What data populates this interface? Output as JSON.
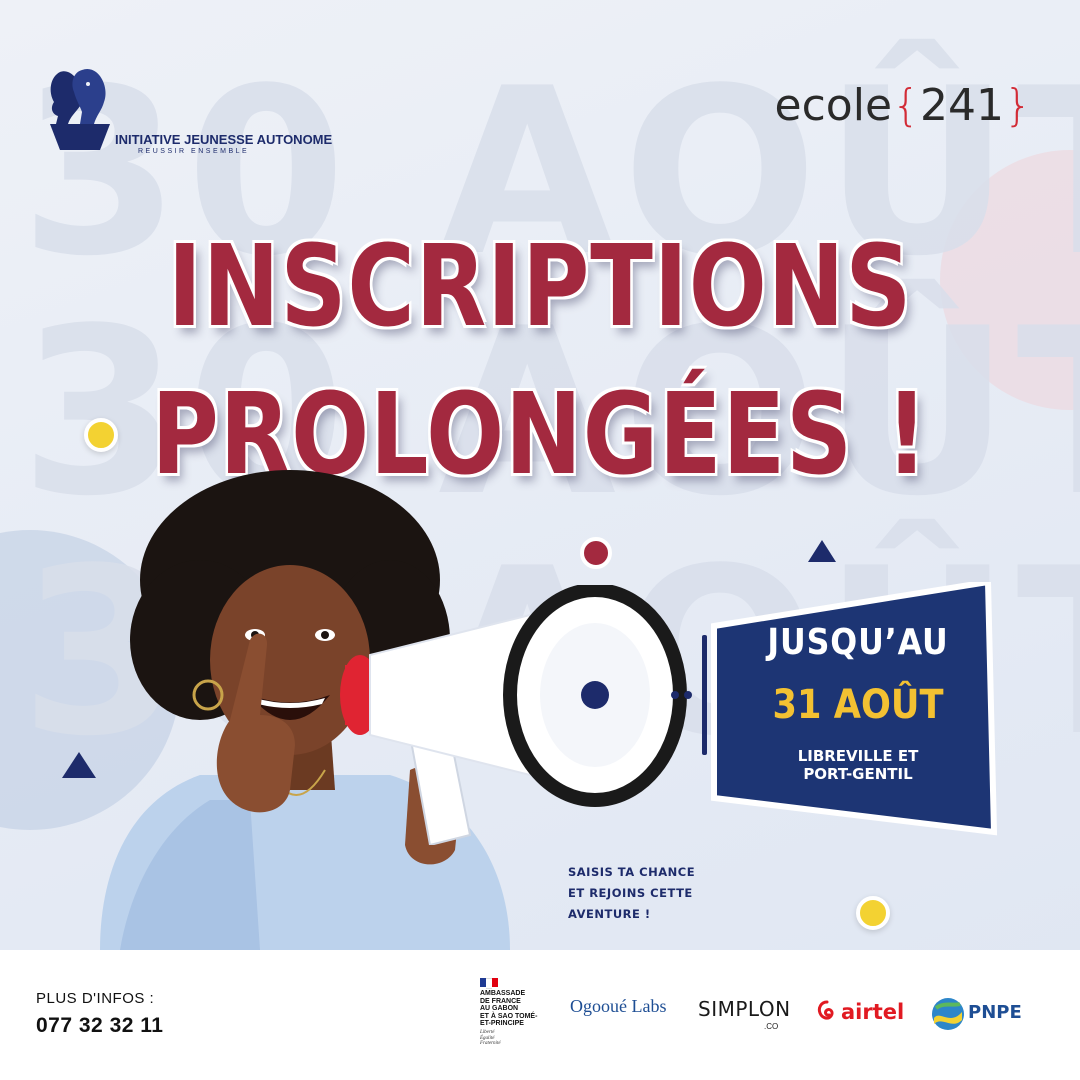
{
  "background_words": {
    "line1": "30 AOÛT",
    "line2": "30 AOÛT",
    "line3": "30 AOÛT"
  },
  "header": {
    "partner_logo": {
      "title": "INITIATIVE JEUNESSE AUTONOME",
      "subtitle": "REUSSIR ENSEMBLE"
    },
    "brand_logo": {
      "word": "ecole",
      "open_brace": "{",
      "number": "241",
      "close_brace": "}"
    }
  },
  "headline": {
    "line1": "INSCRIPTIONS",
    "line2": "PROLONGÉES !"
  },
  "date_box": {
    "line1": "JUSQU’AU",
    "line2": "31 AOÛT",
    "line3": "LIBREVILLE ET\nPORT-GENTIL"
  },
  "tagline": "SAISIS TA CHANCE\nET REJOINS CETTE\nAVENTURE !",
  "footer": {
    "info_label": "PLUS D'INFOS :",
    "phone": "077 32 32 11",
    "sponsors": {
      "embassy": {
        "text": "AMBASSADE\nDE FRANCE\nAU GABON\nET À SAO TOMÉ-\nET-PRINCIPE",
        "motto": "Liberté\nÉgalité\nFraternité"
      },
      "ogooue": "Ogooué Labs",
      "simplon": {
        "name": "SIMPLON",
        "suffix": ".CO"
      },
      "airtel": "airtel",
      "pnpe": "PNPE"
    }
  },
  "colors": {
    "headline": "#a3293f",
    "navy": "#1d2b6b",
    "yellow": "#f3c132",
    "ecole_brace": "#d22b36",
    "airtel_red": "#e11a22"
  },
  "icons": {
    "partner_logo": "silhouette-profiles-icon",
    "megaphone": "megaphone-illustration",
    "airtel": "airtel-swoosh-icon",
    "pnpe": "pnpe-globe-icon",
    "embassy_flag": "french-flag-icon"
  }
}
